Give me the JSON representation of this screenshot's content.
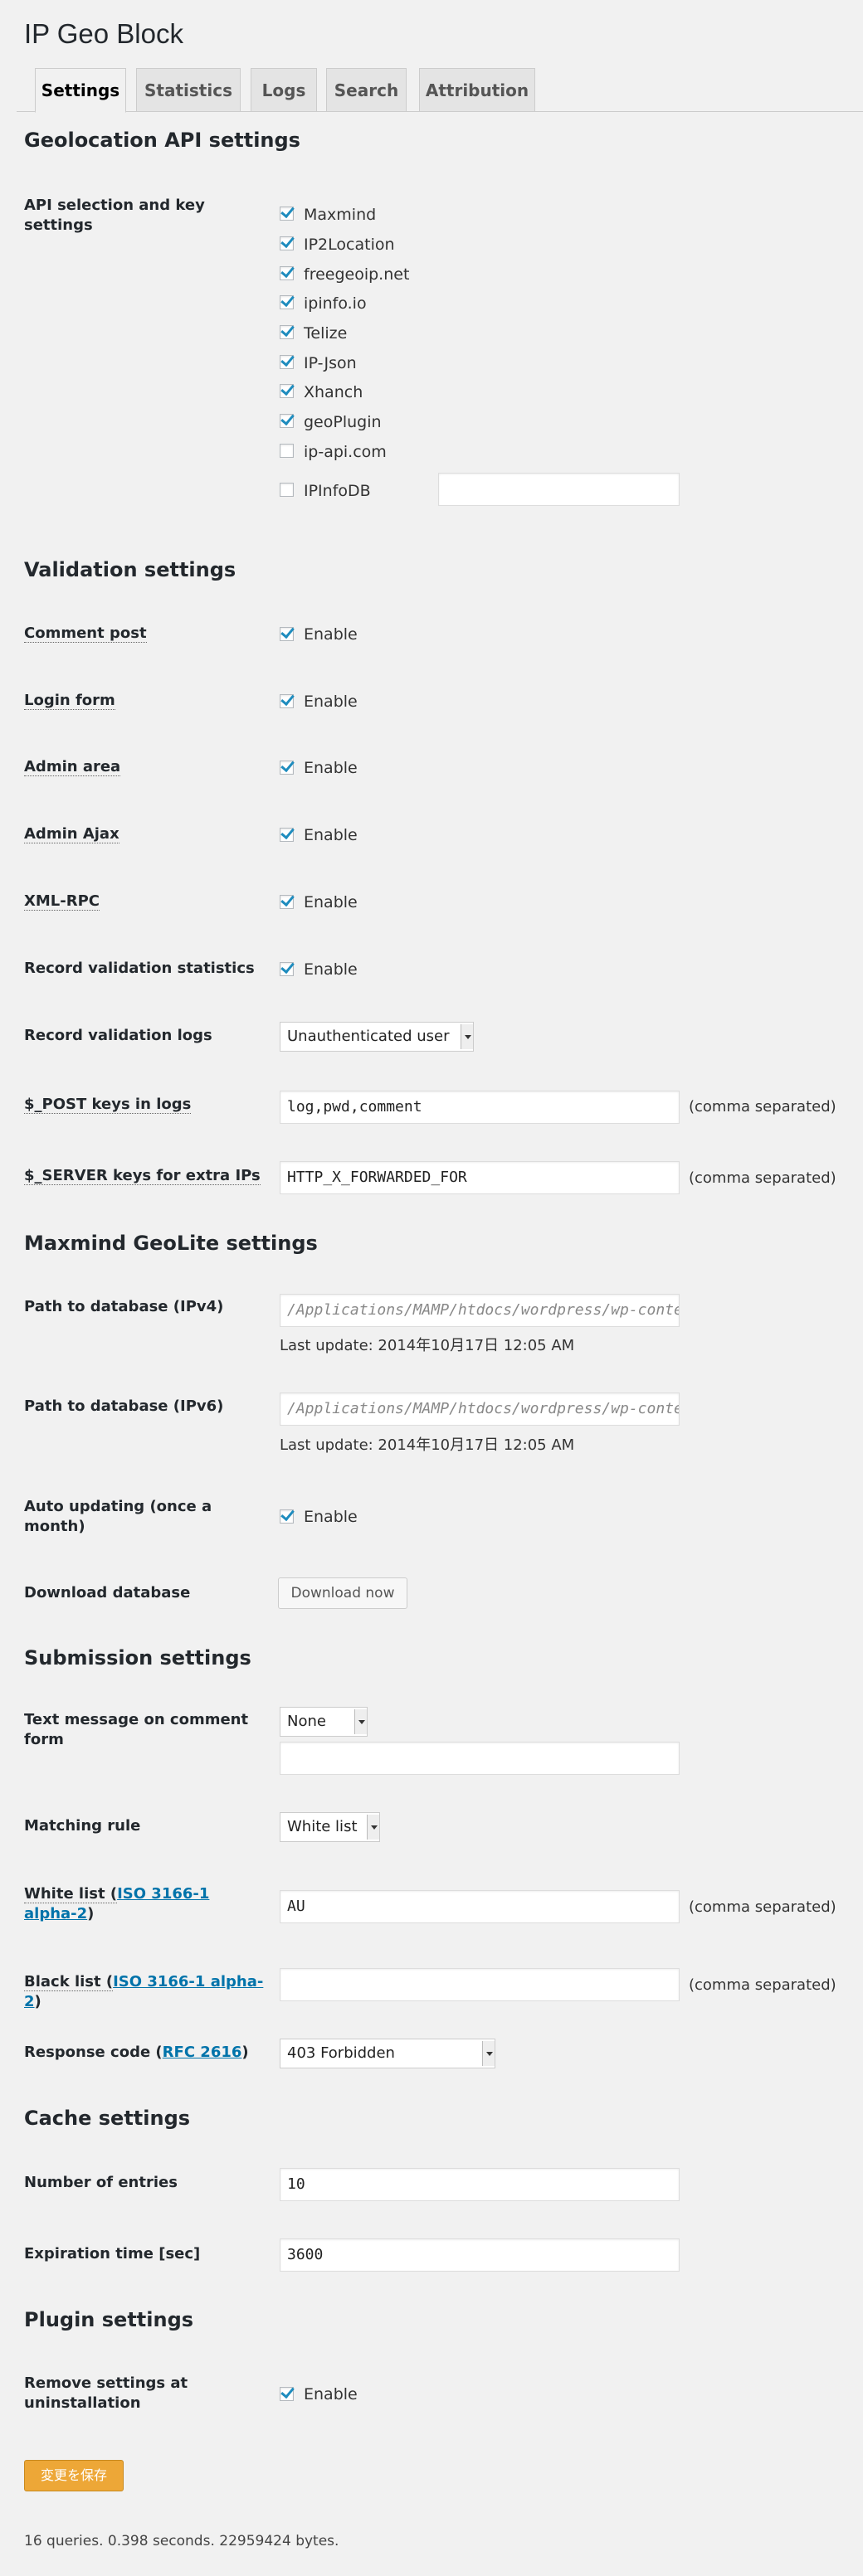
{
  "page_title": "IP Geo Block",
  "tabs": [
    "Settings",
    "Statistics",
    "Logs",
    "Search",
    "Attribution"
  ],
  "sections": {
    "geolocation": "Geolocation API settings",
    "validation": "Validation settings",
    "maxmind": "Maxmind GeoLite settings",
    "submission": "Submission settings",
    "cache": "Cache settings",
    "plugin": "Plugin settings"
  },
  "api": {
    "label": "API selection and key settings",
    "providers": [
      "Maxmind",
      "IP2Location",
      "freegeoip.net",
      "ipinfo.io",
      "Telize",
      "IP-Json",
      "Xhanch",
      "geoPlugin",
      "ip-api.com",
      "IPInfoDB"
    ],
    "checked": [
      true,
      true,
      true,
      true,
      true,
      true,
      true,
      true,
      false,
      false
    ],
    "ipinfodb_key": ""
  },
  "validation": {
    "enable": "Enable",
    "comment_post": "Comment post",
    "login_form": "Login form",
    "admin_area": "Admin area",
    "admin_ajax": "Admin Ajax",
    "xmlrpc": "XML-RPC",
    "record_stats": "Record validation statistics",
    "record_logs": "Record validation logs",
    "record_logs_value": "Unauthenticated user",
    "post_keys_label": "$_POST keys in logs",
    "post_keys_value": "log,pwd,comment",
    "server_keys_label": "$_SERVER keys for extra IPs",
    "server_keys_value": "HTTP_X_FORWARDED_FOR",
    "comma_separated": "(comma separated)"
  },
  "maxmind": {
    "ipv4_label": "Path to database (IPv4)",
    "ipv4_value": "/Applications/MAMP/htdocs/wordpress/wp-content",
    "ipv4_update": "Last update: 2014年10月17日 12:05 AM",
    "ipv6_label": "Path to database (IPv6)",
    "ipv6_value": "/Applications/MAMP/htdocs/wordpress/wp-content",
    "ipv6_update": "Last update: 2014年10月17日 12:05 AM",
    "auto_label_1": "Auto updating (once a",
    "auto_label_2": "month)",
    "download_label": "Download database",
    "download_button": "Download now"
  },
  "submission": {
    "message_label_1": "Text message on comment",
    "message_label_2": "form",
    "message_select": "None",
    "message_text": "",
    "matching_label": "Matching rule",
    "matching_value": "White list",
    "white_label_pre": "White list (",
    "white_label_link1": "ISO 3166-1",
    "white_label_link2": "alpha-2",
    "white_label_post": ")",
    "white_value": "AU",
    "black_label_pre": "Black list (",
    "black_label_link": "ISO 3166-1 alpha-2",
    "black_label_post": ")",
    "black_value": "",
    "response_label_pre": "Response code (",
    "response_label_link": "RFC 2616",
    "response_label_post": ")",
    "response_value": "403 Forbidden"
  },
  "cache": {
    "entries_label": "Number of entries",
    "entries_value": "10",
    "expiration_label": "Expiration time [sec]",
    "expiration_value": "3600"
  },
  "plugin": {
    "remove_label_1": "Remove settings at",
    "remove_label_2": "uninstallation"
  },
  "save_button": "変更を保存",
  "footer": "16 queries. 0.398 seconds. 22959424 bytes."
}
